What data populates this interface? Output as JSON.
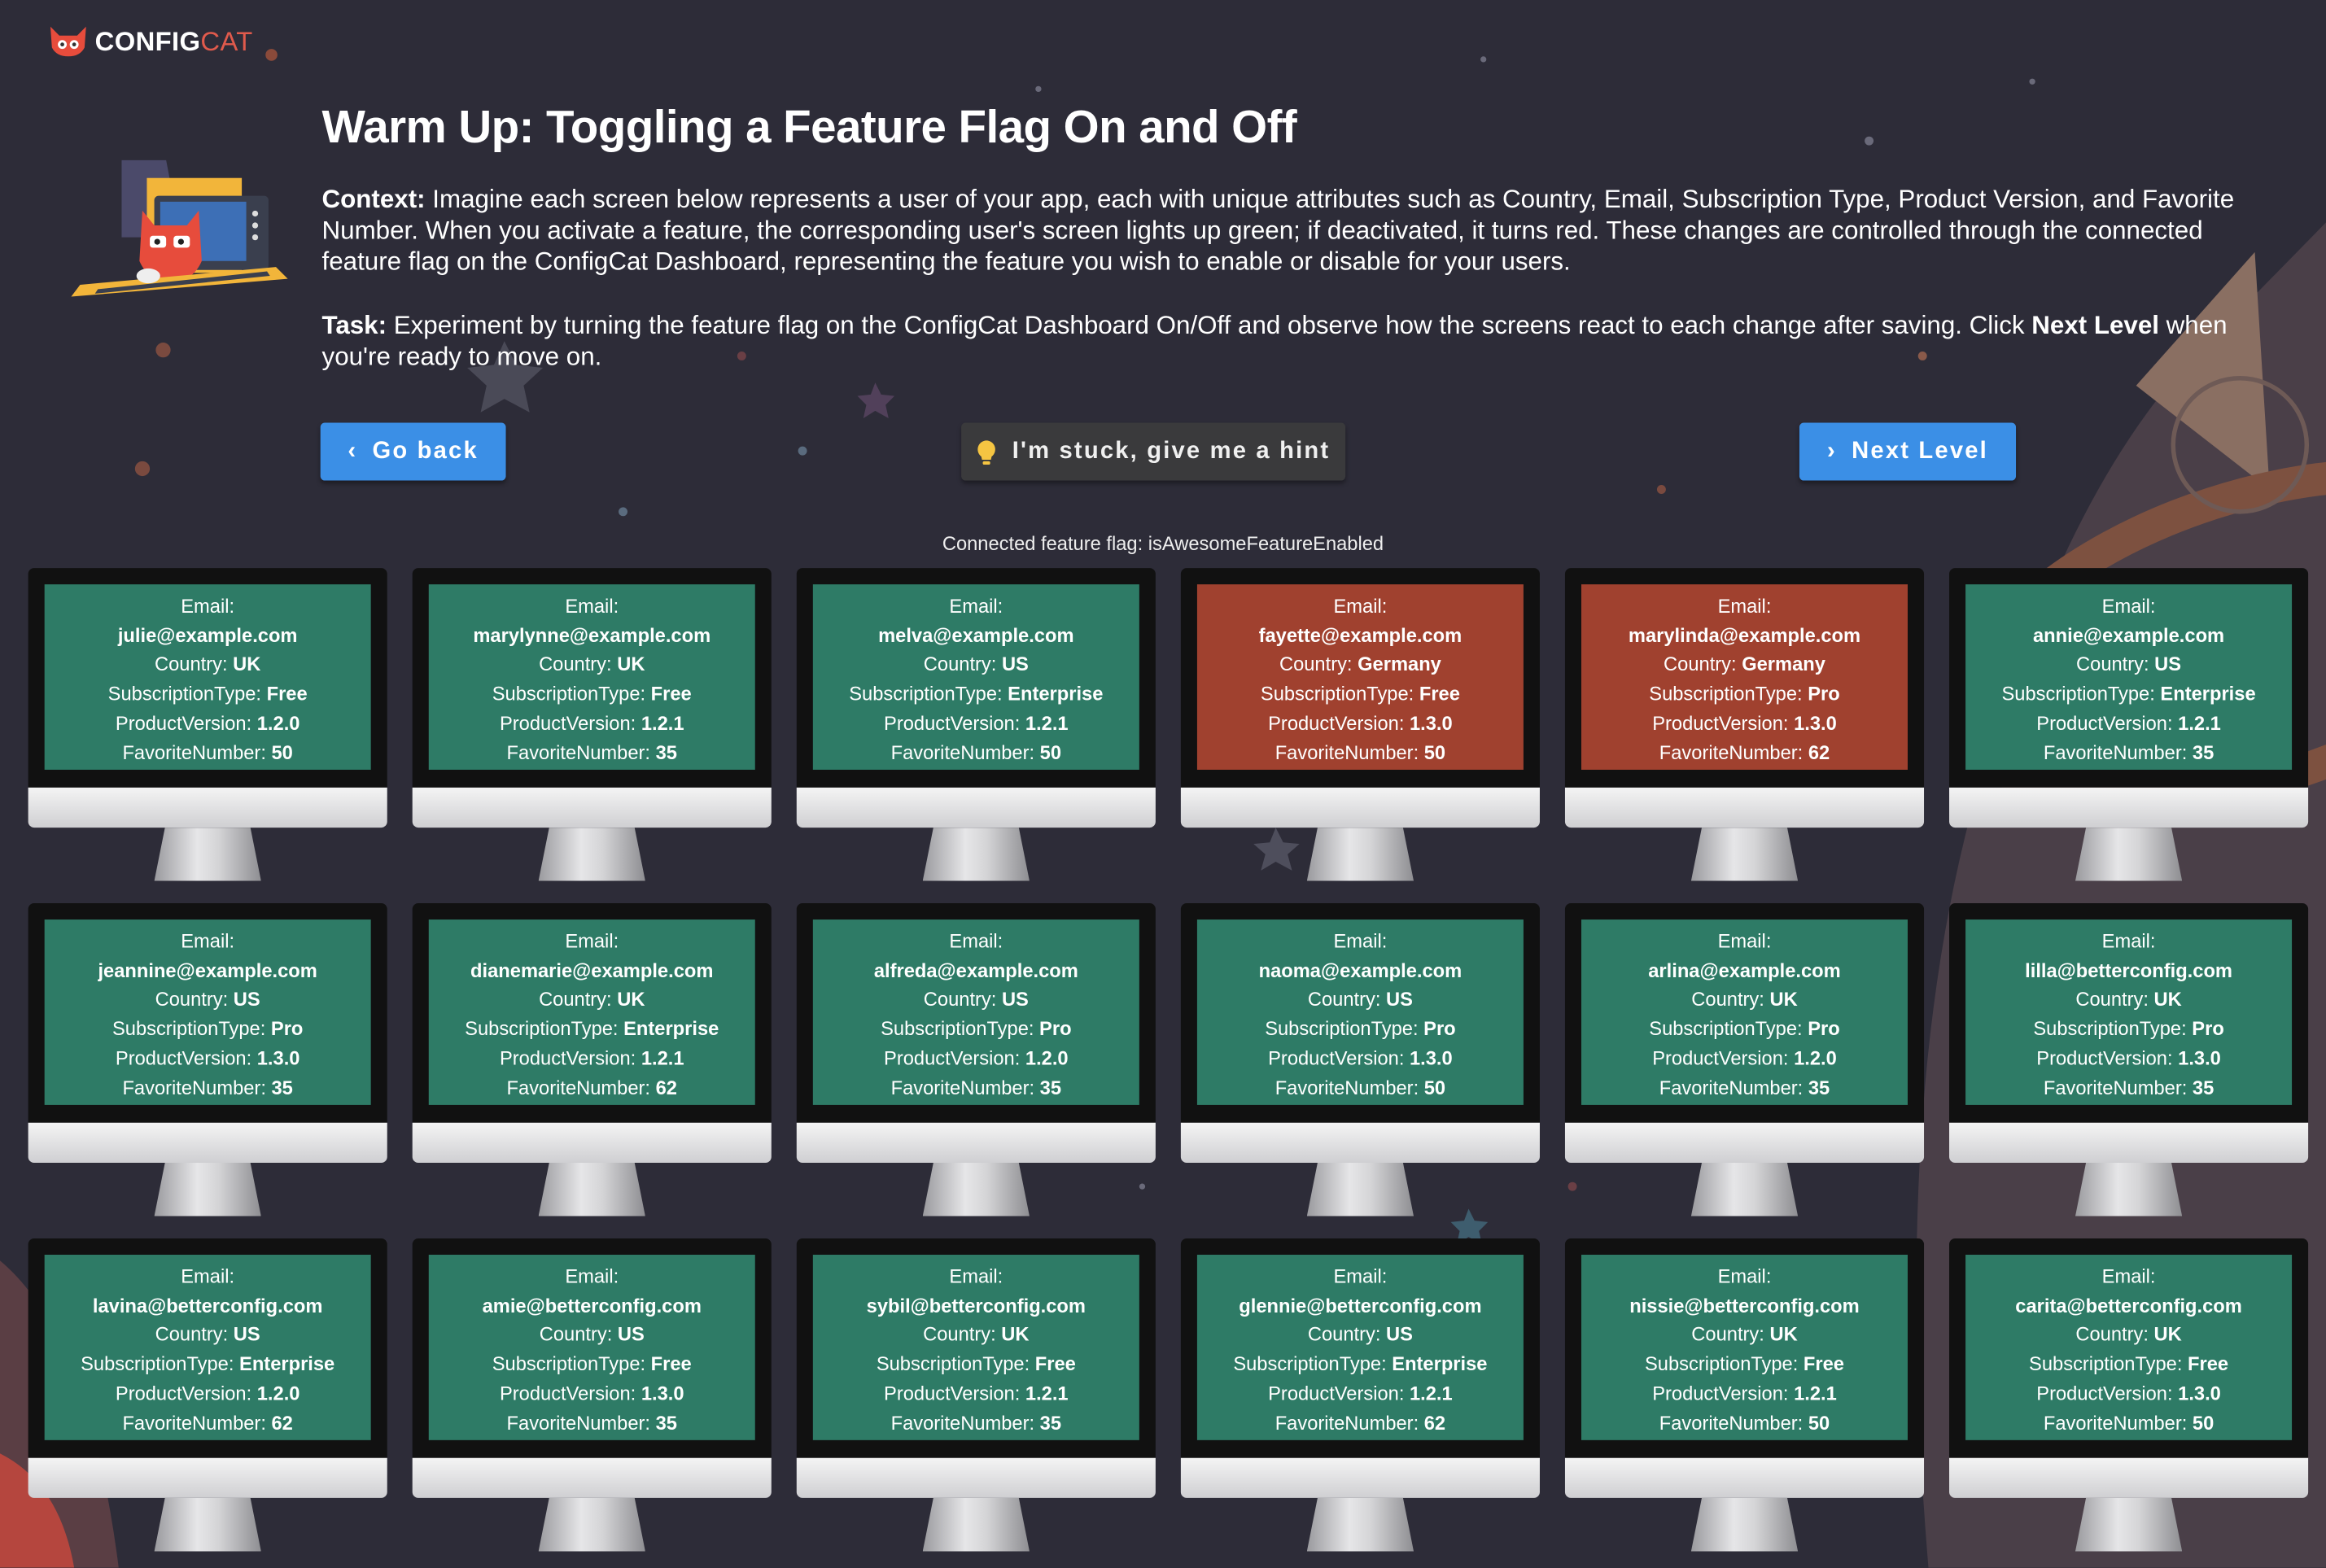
{
  "brand": {
    "name_bold": "CONFIG",
    "name_light": "CAT"
  },
  "header": {
    "title": "Warm Up: Toggling a Feature Flag On and Off",
    "context_label": "Context:",
    "context_text": " Imagine each screen below represents a user of your app, each with unique attributes such as Country, Email, Subscription Type, Product Version, and Favorite Number. When you activate a feature, the corresponding user's screen lights up green; if deactivated, it turns red. These changes are controlled through the connected feature flag on the ConfigCat Dashboard, representing the feature you wish to enable or disable for your users.",
    "task_label": "Task:",
    "task_text_1": " Experiment by turning the feature flag on the ConfigCat Dashboard On/Off and observe how the screens react to each change after saving. Click ",
    "task_bold": "Next Level",
    "task_text_2": " when you're ready to move on."
  },
  "buttons": {
    "back": {
      "label": "Go back",
      "icon": "chevron-left-icon"
    },
    "hint": {
      "label": "I'm stuck, give me a hint",
      "icon": "lightbulb-icon"
    },
    "next": {
      "label": "Next Level",
      "icon": "chevron-right-icon"
    }
  },
  "flag_label": "Connected feature flag: isAwesomeFeatureEnabled",
  "colors": {
    "enabled": "#2e7b66",
    "disabled": "#a0412f",
    "accent": "#3b8fe6"
  },
  "field_labels": {
    "email": "Email:",
    "country": "Country: ",
    "subscription": "SubscriptionType: ",
    "version": "ProductVersion: ",
    "number": "FavoriteNumber: "
  },
  "users": [
    {
      "email": "julie@example.com",
      "country": "UK",
      "subscription": "Free",
      "version": "1.2.0",
      "number": "50",
      "enabled": true
    },
    {
      "email": "marylynne@example.com",
      "country": "UK",
      "subscription": "Free",
      "version": "1.2.1",
      "number": "35",
      "enabled": true
    },
    {
      "email": "melva@example.com",
      "country": "US",
      "subscription": "Enterprise",
      "version": "1.2.1",
      "number": "50",
      "enabled": true
    },
    {
      "email": "fayette@example.com",
      "country": "Germany",
      "subscription": "Free",
      "version": "1.3.0",
      "number": "50",
      "enabled": false
    },
    {
      "email": "marylinda@example.com",
      "country": "Germany",
      "subscription": "Pro",
      "version": "1.3.0",
      "number": "62",
      "enabled": false
    },
    {
      "email": "annie@example.com",
      "country": "US",
      "subscription": "Enterprise",
      "version": "1.2.1",
      "number": "35",
      "enabled": true
    },
    {
      "email": "jeannine@example.com",
      "country": "US",
      "subscription": "Pro",
      "version": "1.3.0",
      "number": "35",
      "enabled": true
    },
    {
      "email": "dianemarie@example.com",
      "country": "UK",
      "subscription": "Enterprise",
      "version": "1.2.1",
      "number": "62",
      "enabled": true
    },
    {
      "email": "alfreda@example.com",
      "country": "US",
      "subscription": "Pro",
      "version": "1.2.0",
      "number": "35",
      "enabled": true
    },
    {
      "email": "naoma@example.com",
      "country": "US",
      "subscription": "Pro",
      "version": "1.3.0",
      "number": "50",
      "enabled": true
    },
    {
      "email": "arlina@example.com",
      "country": "UK",
      "subscription": "Pro",
      "version": "1.2.0",
      "number": "35",
      "enabled": true
    },
    {
      "email": "lilla@betterconfig.com",
      "country": "UK",
      "subscription": "Pro",
      "version": "1.3.0",
      "number": "35",
      "enabled": true
    },
    {
      "email": "lavina@betterconfig.com",
      "country": "US",
      "subscription": "Enterprise",
      "version": "1.2.0",
      "number": "62",
      "enabled": true
    },
    {
      "email": "amie@betterconfig.com",
      "country": "US",
      "subscription": "Free",
      "version": "1.3.0",
      "number": "35",
      "enabled": true
    },
    {
      "email": "sybil@betterconfig.com",
      "country": "UK",
      "subscription": "Free",
      "version": "1.2.1",
      "number": "35",
      "enabled": true
    },
    {
      "email": "glennie@betterconfig.com",
      "country": "US",
      "subscription": "Enterprise",
      "version": "1.2.1",
      "number": "62",
      "enabled": true
    },
    {
      "email": "nissie@betterconfig.com",
      "country": "UK",
      "subscription": "Free",
      "version": "1.2.1",
      "number": "50",
      "enabled": true
    },
    {
      "email": "carita@betterconfig.com",
      "country": "UK",
      "subscription": "Free",
      "version": "1.3.0",
      "number": "50",
      "enabled": true
    }
  ]
}
